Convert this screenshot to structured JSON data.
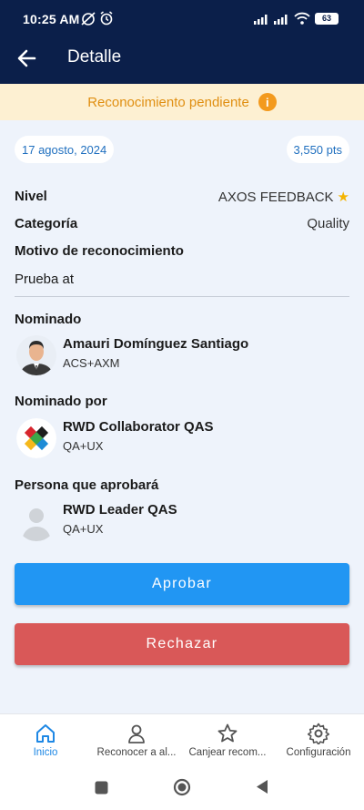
{
  "status": {
    "time": "10:25 AM",
    "battery": "63"
  },
  "appbar": {
    "title": "Detalle"
  },
  "banner": {
    "text": "Reconocimiento pendiente",
    "icon": "info-icon"
  },
  "meta": {
    "date": "17 agosto, 2024",
    "points": "3,550 pts"
  },
  "details": {
    "level_label": "Nivel",
    "level_value": "AXOS FEEDBACK",
    "category_label": "Categoría",
    "category_value": "Quality",
    "reason_label": "Motivo de reconocimiento",
    "reason_value": "Prueba at"
  },
  "nominee": {
    "section": "Nominado",
    "name": "Amauri Domínguez Santiago",
    "team": "ACS+AXM"
  },
  "nominator": {
    "section": "Nominado por",
    "name": "RWD Collaborator QAS",
    "team": "QA+UX"
  },
  "approver": {
    "section": "Persona que aprobará",
    "name": "RWD Leader QAS",
    "team": "QA+UX"
  },
  "actions": {
    "approve": "Aprobar",
    "reject": "Rechazar"
  },
  "nav": [
    {
      "label": "Inicio",
      "icon": "home-icon",
      "active": true
    },
    {
      "label": "Reconocer a al...",
      "icon": "person-icon",
      "active": false
    },
    {
      "label": "Canjear recom...",
      "icon": "star-icon",
      "active": false
    },
    {
      "label": "Configuración",
      "icon": "gear-icon",
      "active": false
    }
  ],
  "colors": {
    "header": "#0b1f4a",
    "banner": "#fdf0d2",
    "accent": "#2196f3",
    "danger": "#d95858",
    "background": "#eef3fb"
  }
}
